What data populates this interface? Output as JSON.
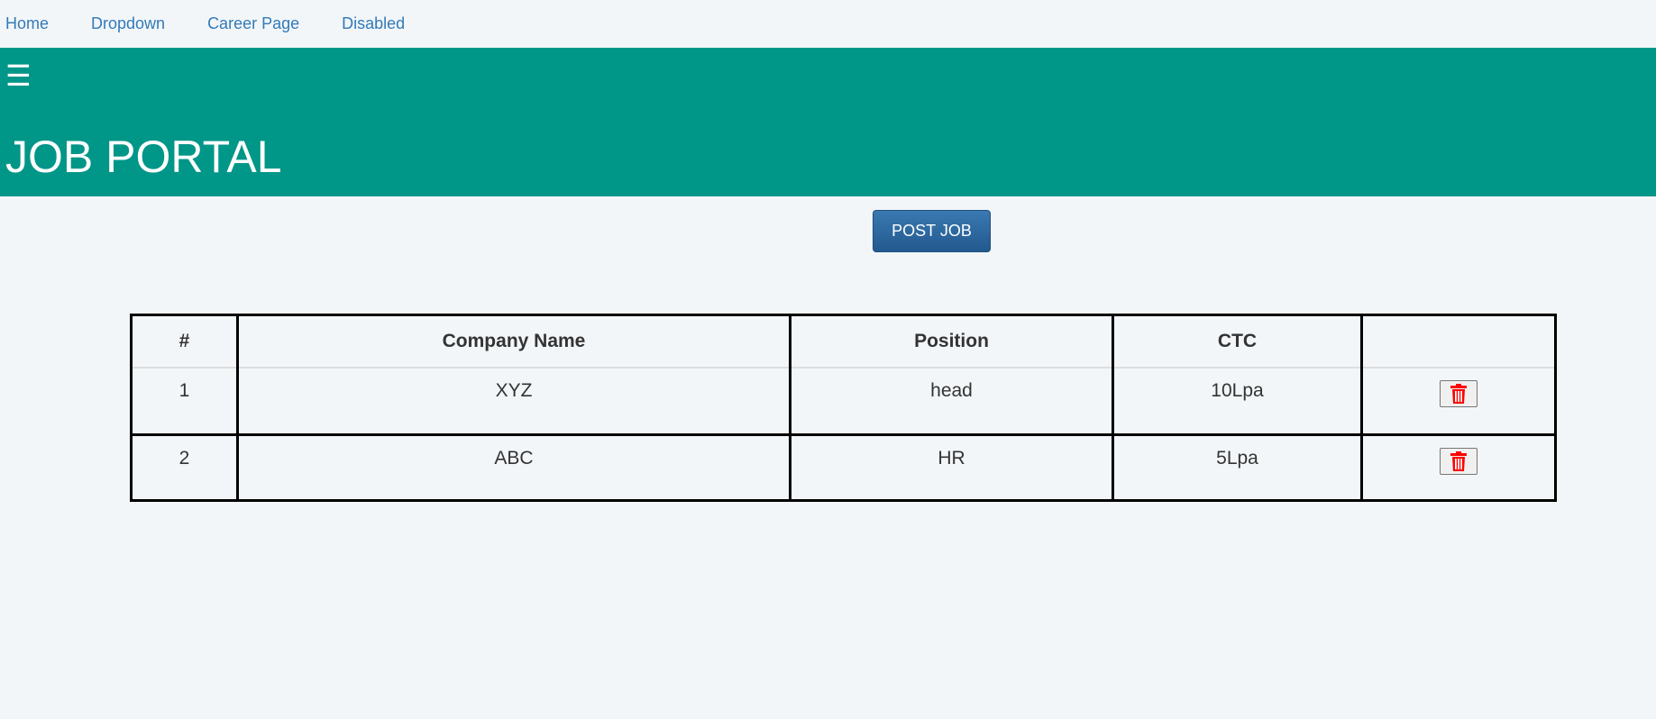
{
  "nav": {
    "items": [
      {
        "label": "Home"
      },
      {
        "label": "Dropdown"
      },
      {
        "label": "Career Page"
      },
      {
        "label": "Disabled"
      }
    ]
  },
  "banner": {
    "menu_icon": "☰",
    "title": "JOB PORTAL",
    "color": "#009688"
  },
  "actions": {
    "post_job_label": "POST JOB",
    "button_color": "#2a6496"
  },
  "table": {
    "headers": [
      "#",
      "Company Name",
      "Position",
      "CTC",
      ""
    ],
    "rows": [
      {
        "index": "1",
        "company": "XYZ",
        "position": "head",
        "ctc": "10Lpa",
        "action_icon": "trash-icon"
      },
      {
        "index": "2",
        "company": "ABC",
        "position": "HR",
        "ctc": "5Lpa",
        "action_icon": "trash-icon"
      }
    ],
    "delete_icon_color": "#ff0000"
  }
}
